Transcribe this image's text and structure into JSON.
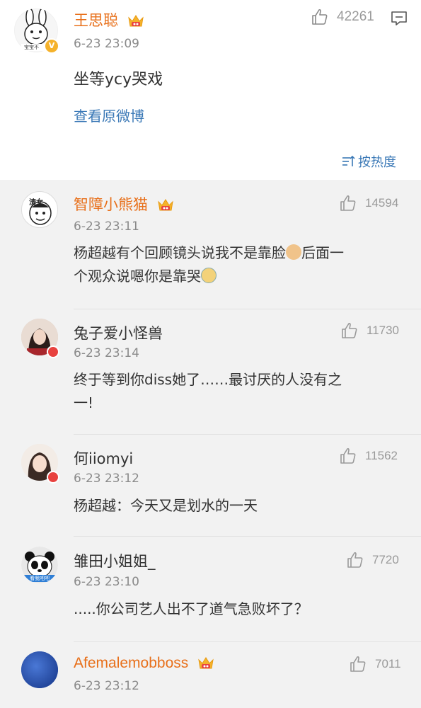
{
  "post": {
    "author": "王思聪",
    "time": "6-23 23:09",
    "likes": "42261",
    "text": "坐等ycy哭戏",
    "view_original": "查看原微博",
    "sort_label": "按热度"
  },
  "comments": [
    {
      "name": "智障小熊猫",
      "time": "6-23 23:11",
      "likes": "14594",
      "text_a": "杨超越有个回顾镜头说我不是靠脸",
      "text_b": "后面一",
      "text_c": "个观众说嗯你是靠哭",
      "name_color": "#e8701b"
    },
    {
      "name": "兔子爱小怪兽",
      "time": "6-23 23:14",
      "likes": "11730",
      "text_line1": "终于等到你diss她了……最讨厌的人没有之",
      "text_line2": "一!",
      "name_color": "#333333"
    },
    {
      "name": "何iiomyi",
      "time": "6-23 23:12",
      "likes": "11562",
      "text_line1": "杨超越：今天又是划水的一天",
      "name_color": "#333333"
    },
    {
      "name": "雏田小姐姐_",
      "time": "6-23 23:10",
      "likes": "7720",
      "text_line1": ".....你公司艺人出不了道气急败坏了？",
      "avatar_caption": "看我吧吧",
      "name_color": "#333333"
    },
    {
      "name": "Afemalemobboss",
      "time": "6-23 23:12",
      "likes": "7011",
      "name_color": "#e8701b"
    }
  ],
  "avatar0_text": "渣女",
  "verified_badge": "V",
  "author_avatar_caption": "宝宝不"
}
